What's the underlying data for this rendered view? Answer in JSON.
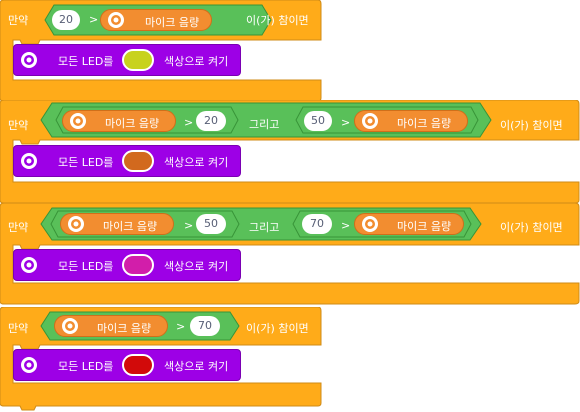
{
  "blocks": [
    {
      "if_label": "만약",
      "condition": {
        "left_value": "20",
        "operator": ">",
        "sensor_label": "마이크 음량"
      },
      "suffix": "이(가) 참이면",
      "action": {
        "label_pre": "모든 LED를",
        "label_post": "색상으로 켜기",
        "color": "#c8d21e"
      }
    },
    {
      "if_label": "만약",
      "condition": {
        "a_sensor": "마이크 음량",
        "a_operator": ">",
        "a_value": "20",
        "join": "그리고",
        "b_value": "50",
        "b_operator": ">",
        "b_sensor": "마이크 음량"
      },
      "suffix": "이(가) 참이면",
      "action": {
        "label_pre": "모든 LED를",
        "label_post": "색상으로 켜기",
        "color": "#d2691e"
      }
    },
    {
      "if_label": "만약",
      "condition": {
        "a_sensor": "마이크 음량",
        "a_operator": ">",
        "a_value": "50",
        "join": "그리고",
        "b_value": "70",
        "b_operator": ">",
        "b_sensor": "마이크 음량"
      },
      "suffix": "이(가) 참이면",
      "action": {
        "label_pre": "모든 LED를",
        "label_post": "색상으로 켜기",
        "color": "#d21eaa"
      }
    },
    {
      "if_label": "만약",
      "condition": {
        "sensor_label": "마이크 음량",
        "operator": ">",
        "value": "70"
      },
      "suffix": "이(가) 참이면",
      "action": {
        "label_pre": "모든 LED를",
        "label_post": "색상으로 켜기",
        "color": "#d20a0a"
      }
    }
  ],
  "colors": {
    "control_orange": "#ffab19",
    "control_orange_dark": "#cf8b17",
    "operator_green": "#59c059",
    "operator_green_dark": "#389438",
    "sensor_orange": "#f28d30",
    "looks_purple": "#9d00e6",
    "looks_purple_dark": "#7a00b3"
  },
  "icons": {
    "sensor": "gear-icon",
    "led": "gear-icon"
  }
}
